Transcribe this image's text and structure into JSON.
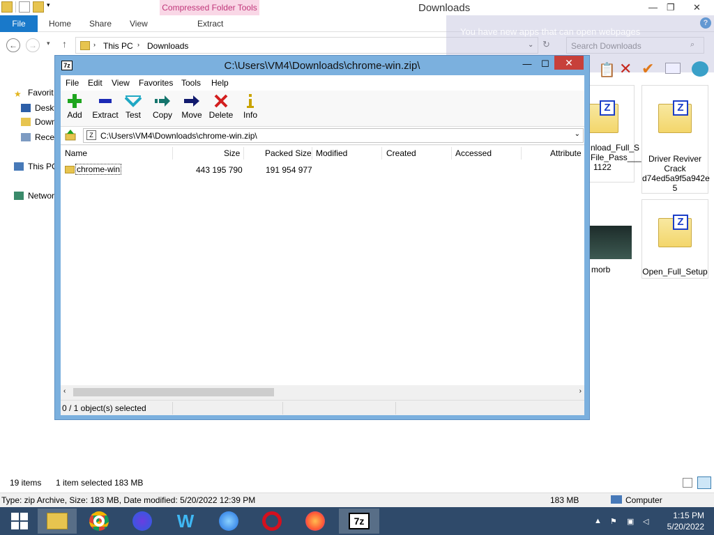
{
  "explorer": {
    "title": "Downloads",
    "context_tab": "Compressed Folder Tools",
    "ribbon_tabs": [
      "File",
      "Home",
      "Share",
      "View",
      "Extract"
    ],
    "breadcrumb": [
      "This PC",
      "Downloads"
    ],
    "search_placeholder": "Search Downloads",
    "notification": "You have new apps that can open webpages",
    "nav_items": [
      "Favorit",
      "Deskt",
      "Down",
      "Recer",
      "This PC",
      "Networ"
    ],
    "tiles": [
      {
        "line1": "nload_Full_S",
        "line2": "File_Pass___",
        "line3": "1122"
      },
      {
        "line1": "Driver Reviver",
        "line2": "Crack",
        "line3": "d74ed5a9f5a942e",
        "line4": "5"
      },
      {
        "line1": "morb"
      },
      {
        "line1": "Open_Full_Setup"
      }
    ],
    "status_items": "19 items",
    "status_selected": "1 item selected  183 MB",
    "details_text": "Type: zip Archive, Size: 183 MB, Date modified: 5/20/2022 12:39 PM",
    "details_size": "183 MB",
    "details_location": "Computer"
  },
  "sevenzip": {
    "title": "C:\\Users\\VM4\\Downloads\\chrome-win.zip\\",
    "logo": "7z",
    "menu": [
      "File",
      "Edit",
      "View",
      "Favorites",
      "Tools",
      "Help"
    ],
    "toolbar": [
      "Add",
      "Extract",
      "Test",
      "Copy",
      "Move",
      "Delete",
      "Info"
    ],
    "path": "C:\\Users\\VM4\\Downloads\\chrome-win.zip\\",
    "columns": [
      "Name",
      "Size",
      "Packed Size",
      "Modified",
      "Created",
      "Accessed",
      "Attribute"
    ],
    "rows": [
      {
        "name": "chrome-win",
        "size": "443 195 790",
        "packed": "191 954 977"
      }
    ],
    "status": "0 / 1 object(s) selected"
  },
  "taskbar": {
    "time": "1:15 PM",
    "date": "5/20/2022",
    "active_app_label": "7z"
  },
  "colors": {
    "accent": "#1979ca",
    "window_frame": "#7bb0de",
    "close_red": "#c7403a",
    "taskbar": "#2f4a6a"
  }
}
